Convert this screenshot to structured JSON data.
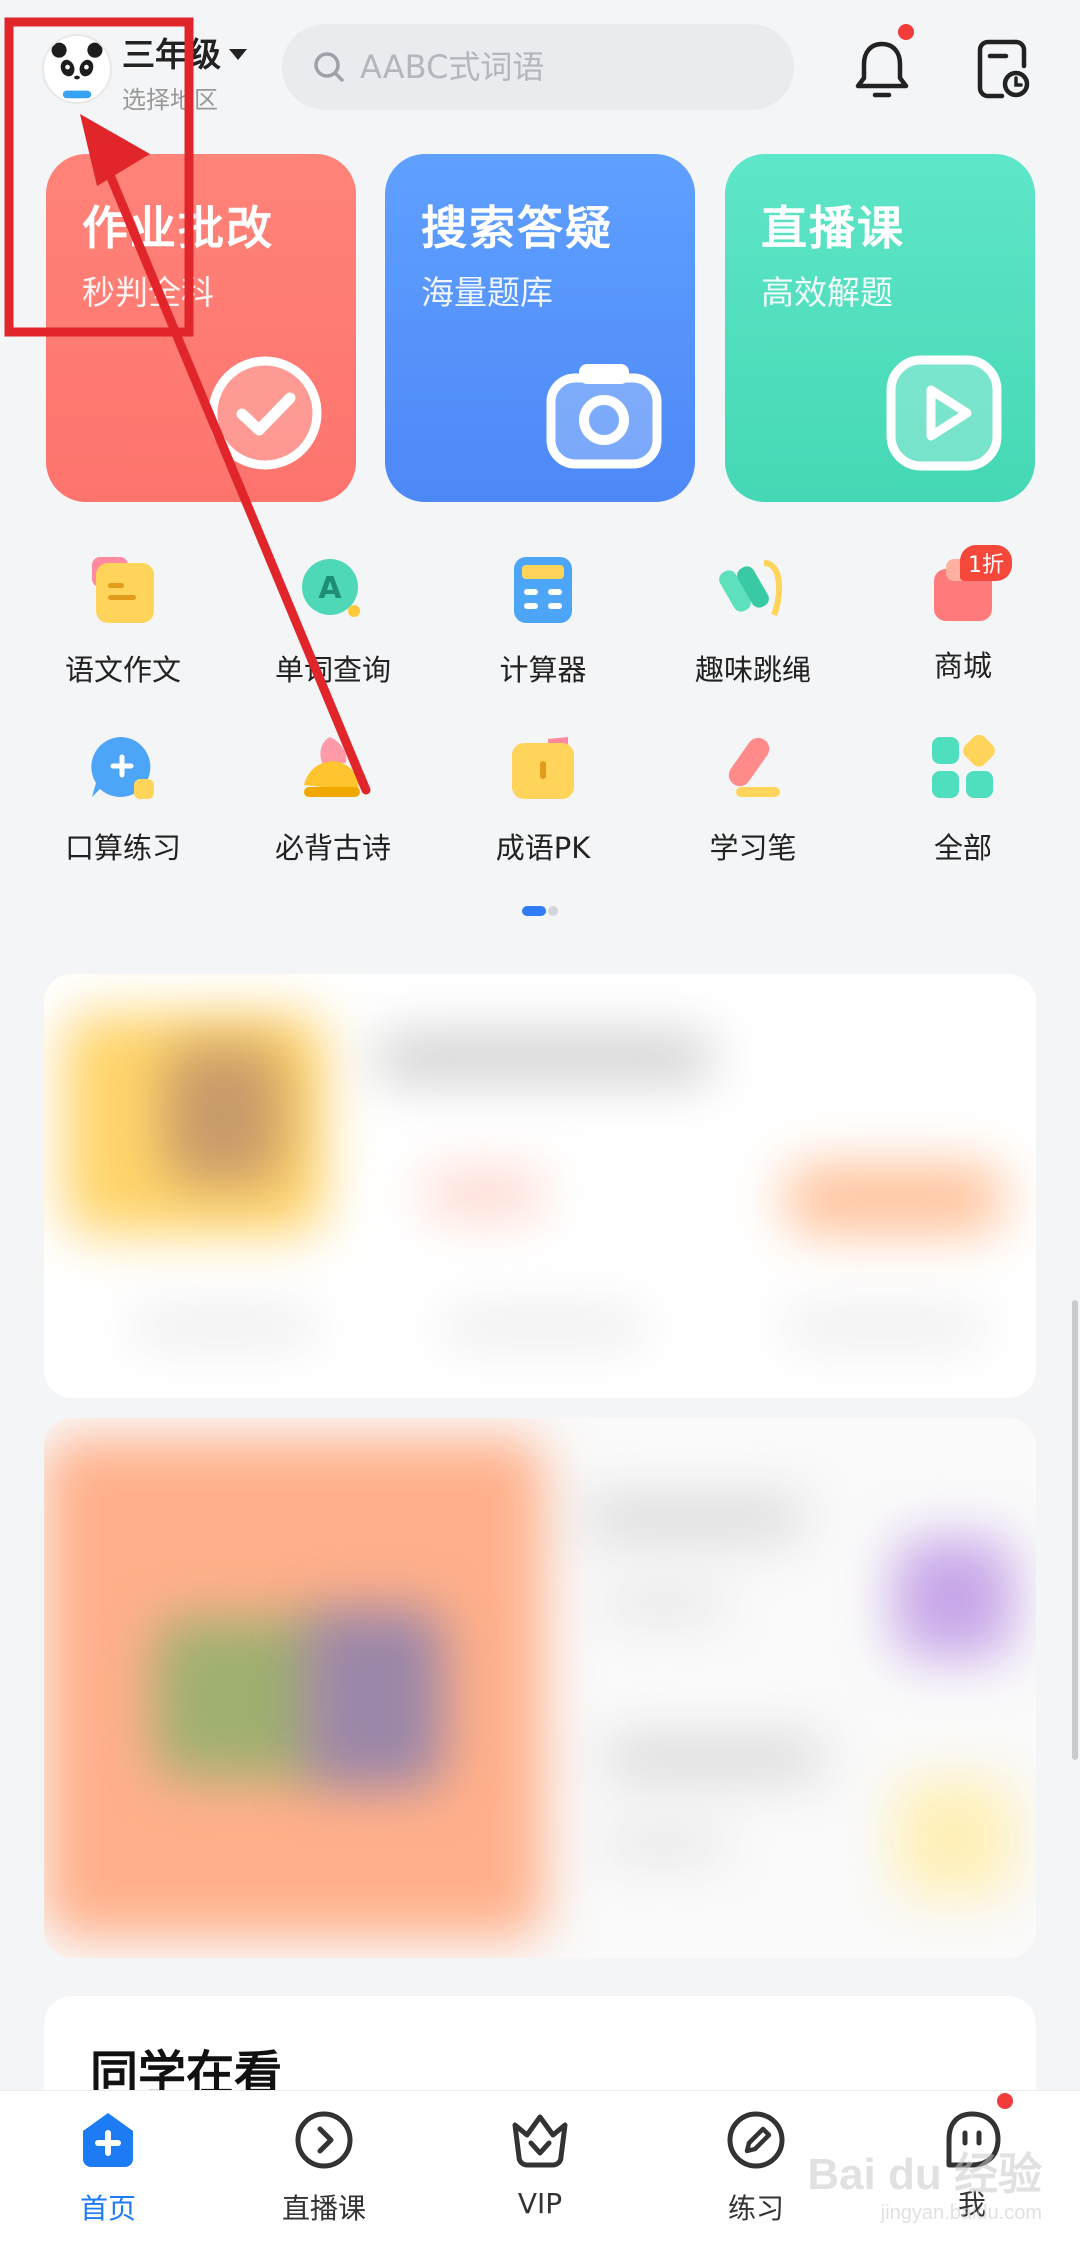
{
  "header": {
    "grade": "三年级",
    "region": "选择地区",
    "search_placeholder": "AABC式词语"
  },
  "cards": [
    {
      "title": "作业批改",
      "subtitle": "秒判全科",
      "icon": "check-circle-icon",
      "color": "#fd7a71"
    },
    {
      "title": "搜索答疑",
      "subtitle": "海量题库",
      "icon": "camera-icon",
      "color": "#5594fa"
    },
    {
      "title": "直播课",
      "subtitle": "高效解题",
      "icon": "play-icon",
      "color": "#4fdfbe"
    }
  ],
  "tools": [
    {
      "label": "语文作文",
      "icon": "note-icon"
    },
    {
      "label": "单词查询",
      "icon": "word-search-icon"
    },
    {
      "label": "计算器",
      "icon": "calculator-icon"
    },
    {
      "label": "趣味跳绳",
      "icon": "jump-rope-icon"
    },
    {
      "label": "商城",
      "icon": "shop-bag-icon",
      "badge": "1折"
    },
    {
      "label": "口算练习",
      "icon": "chat-plus-icon"
    },
    {
      "label": "必背古诗",
      "icon": "poem-hat-icon"
    },
    {
      "label": "成语PK",
      "icon": "book-icon"
    },
    {
      "label": "学习笔",
      "icon": "pen-icon"
    },
    {
      "label": "全部",
      "icon": "grid-icon"
    }
  ],
  "peer_section": {
    "title": "同学在看"
  },
  "tabbar": [
    {
      "label": "首页",
      "icon": "home-plus-icon",
      "active": true
    },
    {
      "label": "直播课",
      "icon": "play-circle-icon"
    },
    {
      "label": "VIP",
      "icon": "vip-crown-icon"
    },
    {
      "label": "练习",
      "icon": "pencil-circle-icon"
    },
    {
      "label": "我",
      "icon": "face-icon"
    }
  ],
  "watermark": {
    "brand": "Bai du 经验",
    "url": "jingyan.baidu.com"
  },
  "colors": {
    "accent": "#1d7bf4",
    "annotation": "#e0262b"
  }
}
